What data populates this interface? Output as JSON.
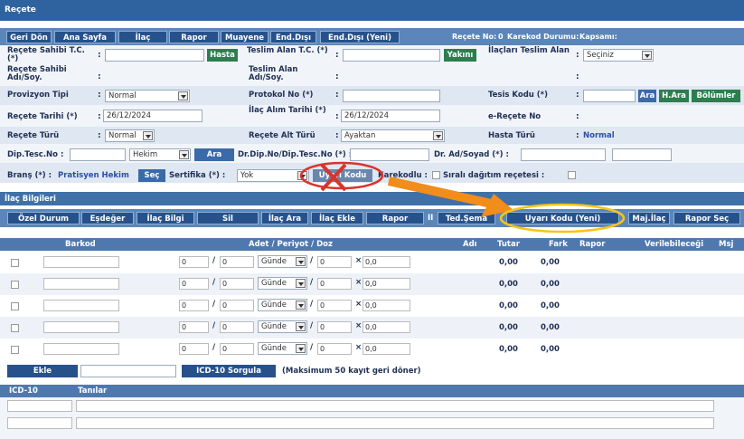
{
  "window": {
    "title": "Reçete"
  },
  "nav": {
    "buttons": [
      "Geri Dön",
      "Ana Sayfa",
      "İlaç",
      "Rapor",
      "Muayene",
      "End.Dışı",
      "End.Dışı (Yeni)"
    ],
    "recete_no_label": "Reçete No:",
    "recete_no_value": "0",
    "karekod_label": "Karekod Durumu:",
    "kapsami_label": "Kapsamı:"
  },
  "form": {
    "recete_sahibi_tc": "Reçete Sahibi T.C. (*)",
    "hasta_button": "Hasta",
    "teslim_alan_tc": "Teslim Alan T.C. (*)",
    "yakini_button": "Yakını",
    "ilaclari_teslim_alan": "İlaçları Teslim Alan",
    "teslim_value": "Seçiniz",
    "recete_sahibi_ad": "Reçete Sahibi Adı/Soy.",
    "teslim_alan_ad": "Teslim Alan Adı/Soy.",
    "provizyon_tipi": "Provizyon Tipi",
    "provizyon_value": "Normal",
    "protokol_no": "Protokol No (*)",
    "tesis_kodu": "Tesis Kodu (*)",
    "ara_button": "Ara",
    "hara_button": "H.Ara",
    "bolumler_button": "Bölümler",
    "recete_tarihi": "Reçete Tarihi (*)",
    "recete_tarihi_value": "26/12/2024",
    "ilac_alim_tarihi": "İlaç Alım Tarihi (*)",
    "ilac_alim_value": "26/12/2024",
    "e_recete_no": "e-Reçete No",
    "recete_turu": "Reçete Türü",
    "recete_turu_value": "Normal",
    "recete_alt_turu": "Reçete Alt Türü",
    "recete_alt_value": "Ayaktan",
    "hasta_turu": "Hasta Türü",
    "hasta_turu_value": "Normal",
    "dip_tesc_no": "Dip.Tesc.No :",
    "hekim_value": "Hekim",
    "ara2_button": "Ara",
    "dr_dip_label": "Dr.Dip.No/Dip.Tesc.No (*) :",
    "dr_ad_label": "Dr. Ad/Soyad (*) :",
    "brans_label": "Branş (*) :",
    "brans_value": "Pratisyen Hekim",
    "sec_button": "Seç",
    "sertifika_label": "Sertifika (*) :",
    "sertifika_value": "Yok",
    "uyari_kodu_button": "Uyarı Kodu",
    "karekodlu_label": "Karekodlu :",
    "sirali_label": "Sıralı dağıtım reçetesi :"
  },
  "ilac": {
    "section_title": "İlaç Bilgileri",
    "toolbar": [
      "Özel Durum",
      "Eşdeğer",
      "İlaç Bilgi",
      "Sil",
      "İlaç Ara",
      "İlaç Ekle",
      "Rapor",
      "Ted.Şema",
      "Uyarı Kodu (Yeni)",
      "Maj.İlaç",
      "Rapor Seç"
    ],
    "separator": "II",
    "columns": [
      "Barkod",
      "Adet / Periyot / Doz",
      "Adı",
      "Tutar",
      "Fark",
      "Rapor",
      "Verilebileceği",
      "Msj"
    ],
    "rows": [
      {
        "adet": "0",
        "periyot": "0",
        "birim": "Günde",
        "doz1": "0",
        "doz2": "0,0",
        "tutar": "0,00",
        "fark": "0,00"
      },
      {
        "adet": "0",
        "periyot": "0",
        "birim": "Günde",
        "doz1": "0",
        "doz2": "0,0",
        "tutar": "0,00",
        "fark": "0,00"
      },
      {
        "adet": "0",
        "periyot": "0",
        "birim": "Günde",
        "doz1": "0",
        "doz2": "0,0",
        "tutar": "0,00",
        "fark": "0,00"
      },
      {
        "adet": "0",
        "periyot": "0",
        "birim": "Günde",
        "doz1": "0",
        "doz2": "0,0",
        "tutar": "0,00",
        "fark": "0,00"
      },
      {
        "adet": "0",
        "periyot": "0",
        "birim": "Günde",
        "doz1": "0",
        "doz2": "0,0",
        "tutar": "0,00",
        "fark": "0,00"
      }
    ],
    "ekle_button": "Ekle",
    "icd_sorgula_button": "ICD-10 Sorgula",
    "icd_note": "(Maksimum 50 kayıt geri döner)"
  },
  "icd": {
    "columns": [
      "ICD-10",
      "Tanılar"
    ]
  },
  "annotations": {
    "arrow_color": "#f28c1a",
    "circle_yellow": "#f5c518",
    "circle_red": "#d9342b"
  }
}
